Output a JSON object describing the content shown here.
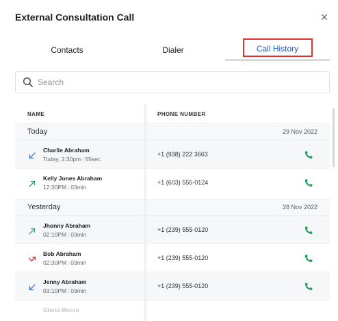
{
  "dialog": {
    "title": "External Consultation Call",
    "close_symbol": "×"
  },
  "tabs": [
    {
      "label": "Contacts"
    },
    {
      "label": "Dialer"
    },
    {
      "label": "Call History"
    }
  ],
  "search": {
    "placeholder": "Search",
    "value": ""
  },
  "table": {
    "columns": [
      "NAME",
      "PHONE NUMBER"
    ],
    "groups": [
      {
        "label": "Today",
        "date": "29 Nov  2022",
        "rows": [
          {
            "name": "Charlie Abraham",
            "time": "Today, 2:30pm",
            "duration": "55sec",
            "phone": "+1 (938) 222 3663",
            "direction": "incoming",
            "icon": "arrow-down-left-icon",
            "color": "#3a74d8"
          },
          {
            "name": "Kelly Jones Abraham",
            "time": "12:30PM",
            "duration": "03min",
            "phone": "+1 (603) 555-0124",
            "direction": "outgoing",
            "icon": "arrow-up-right-icon",
            "color": "#2ea56a"
          }
        ]
      },
      {
        "label": "Yesterday",
        "date": "28 Nov  2022",
        "rows": [
          {
            "name": "Jhonny Abraham",
            "time": "02:10PM",
            "duration": "03min",
            "phone": "+1 (239) 555-0120",
            "direction": "outgoing",
            "icon": "arrow-up-right-icon",
            "color": "#2ea56a"
          },
          {
            "name": "Bob Abraham",
            "time": "02:30PM",
            "duration": "03min",
            "phone": "+1 (239) 555-0120",
            "direction": "missed",
            "icon": "missed-call-icon",
            "color": "#e0312f"
          },
          {
            "name": "Jenny Abraham",
            "time": "03:10PM",
            "duration": "03min",
            "phone": "+1 (239) 555-0120",
            "direction": "incoming",
            "icon": "arrow-down-left-icon",
            "color": "#3a74d8"
          }
        ]
      }
    ],
    "partial_row_name": "Gloria Moore"
  },
  "colors": {
    "accent": "#2154c9",
    "highlight_border": "#e0312f",
    "call_button": "#1f9d55"
  }
}
